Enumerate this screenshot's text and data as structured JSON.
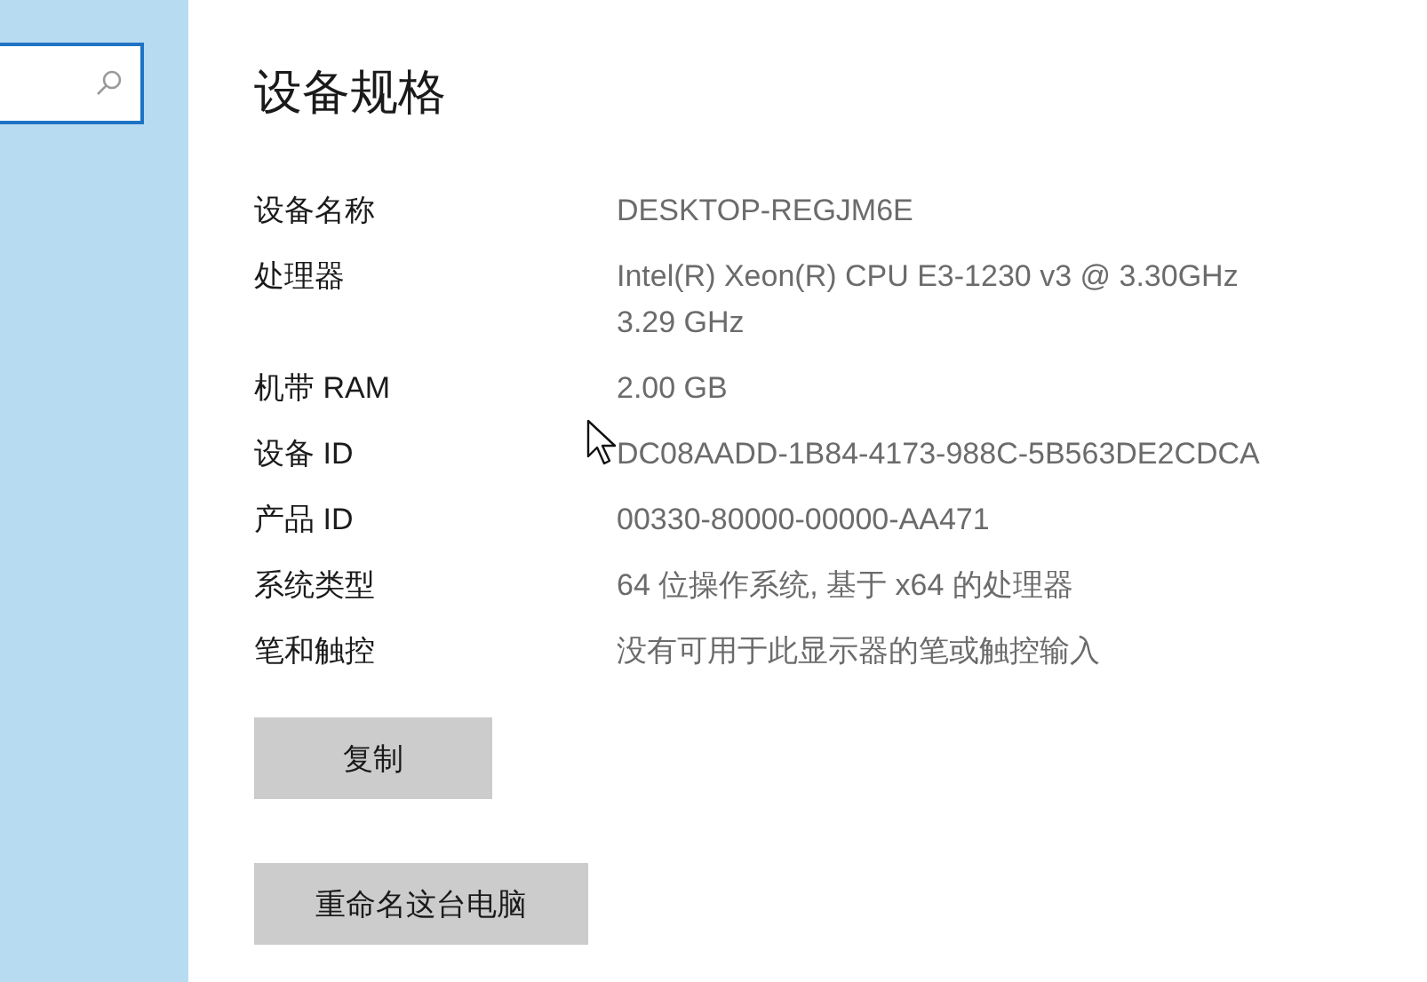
{
  "section": {
    "title": "设备规格"
  },
  "specs": [
    {
      "label": "设备名称",
      "value": "DESKTOP-REGJM6E"
    },
    {
      "label": "处理器",
      "value": "Intel(R) Xeon(R) CPU E3-1230 v3 @ 3.30GHz\n3.29 GHz"
    },
    {
      "label": "机带 RAM",
      "value": "2.00 GB"
    },
    {
      "label": "设备 ID",
      "value": "DC08AADD-1B84-4173-988C-5B563DE2CDCA"
    },
    {
      "label": "产品 ID",
      "value": "00330-80000-00000-AA471"
    },
    {
      "label": "系统类型",
      "value": "64 位操作系统, 基于 x64 的处理器"
    },
    {
      "label": "笔和触控",
      "value": "没有可用于此显示器的笔或触控输入"
    }
  ],
  "buttons": [
    {
      "label": "复制",
      "kind": "copy"
    },
    {
      "label": "重命名这台电脑",
      "kind": "rename"
    }
  ]
}
